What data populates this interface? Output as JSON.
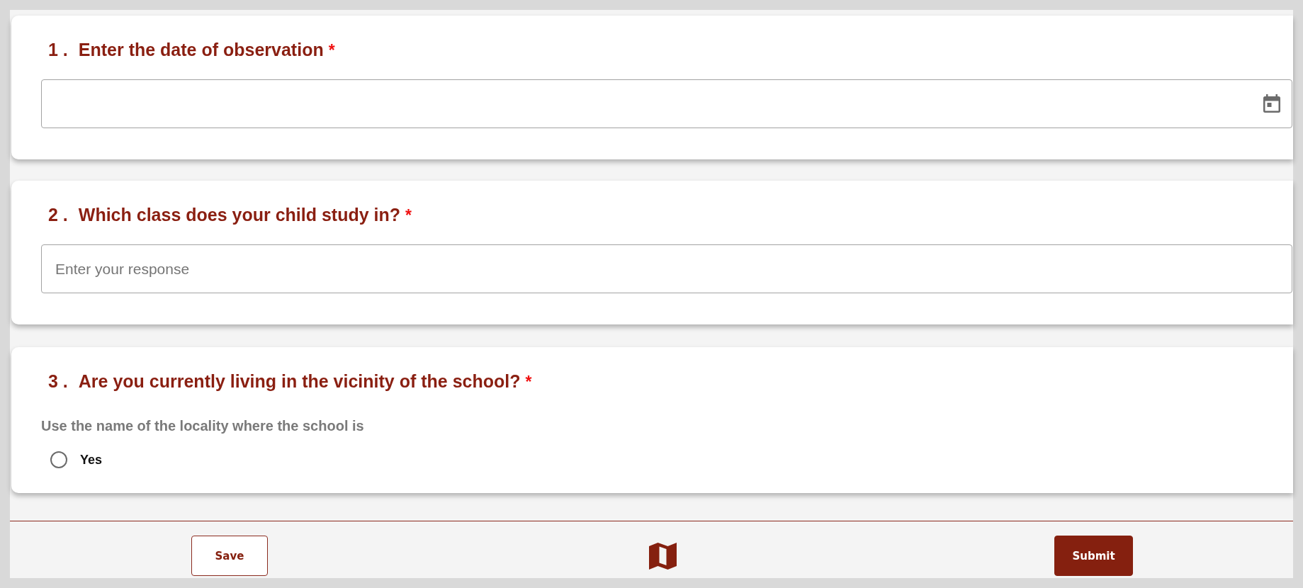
{
  "questions": [
    {
      "number": "1 .",
      "title": "Enter the date of observation",
      "required_mark": "*",
      "kind": "date"
    },
    {
      "number": "2 .",
      "title": "Which class does your child study in?",
      "required_mark": "*",
      "kind": "text",
      "placeholder": "Enter your response"
    },
    {
      "number": "3 .",
      "title": "Are you currently living in the vicinity of the school?",
      "required_mark": "*",
      "kind": "choice",
      "hint": "Use the name of the locality where the school is",
      "options": [
        {
          "label": "Yes",
          "selected": false
        }
      ]
    }
  ],
  "footer": {
    "save_button": {
      "label": "Save"
    },
    "submit_button": {
      "label": "Submit"
    }
  }
}
